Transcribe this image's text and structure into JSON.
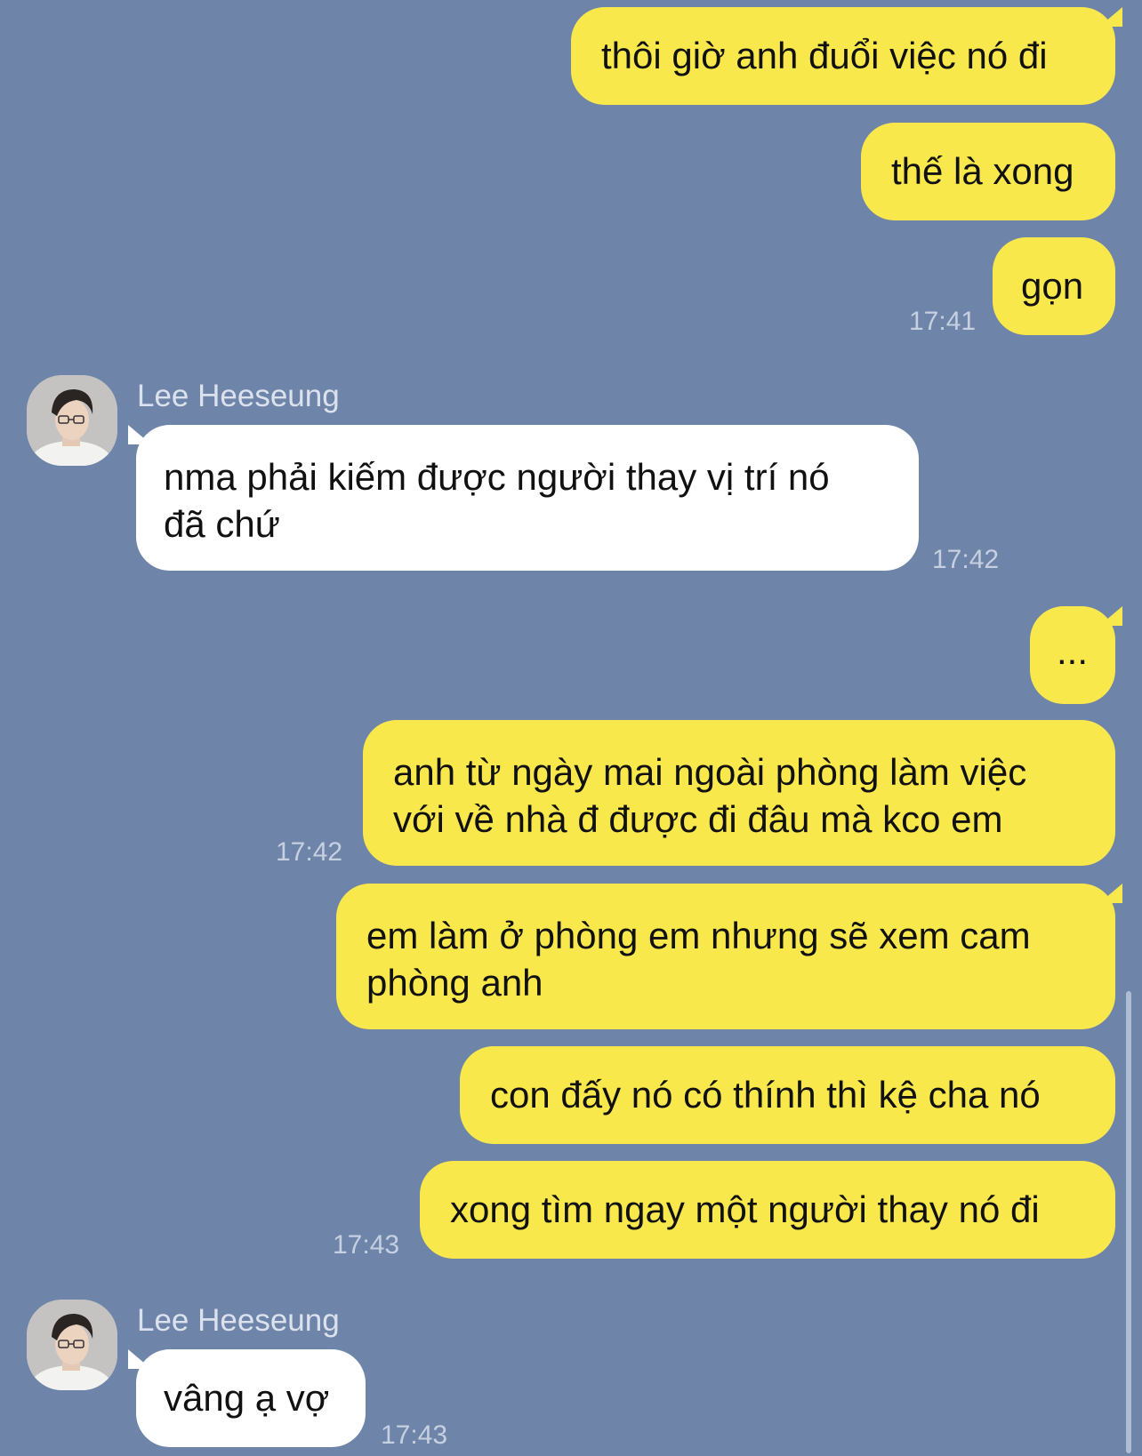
{
  "contact": {
    "name": "Lee Heeseung"
  },
  "messages": {
    "m1": "thôi giờ anh đuổi việc nó đi",
    "m2": "thế là xong",
    "m3": "gọn",
    "t1": "17:41",
    "m4_line1": "nma phải kiếm được người thay vị trí nó",
    "m4_line2": "đã chứ",
    "t2": "17:42",
    "m5": "...",
    "m6_line1": "anh từ ngày mai ngoài phòng làm việc",
    "m6_line2": "với về nhà đ được đi đâu mà kco em",
    "t3": "17:42",
    "m7_line1": "em làm ở phòng em nhưng sẽ xem cam",
    "m7_line2": "phòng anh",
    "m8": "con đấy nó có thính thì kệ cha nó",
    "m9": "xong tìm ngay một người thay nó đi",
    "t4": "17:43",
    "m10": "vâng ạ vợ",
    "t5": "17:43"
  },
  "colors": {
    "background": "#6e84a8",
    "outgoing_bubble": "#f9e84c",
    "incoming_bubble": "#ffffff"
  }
}
